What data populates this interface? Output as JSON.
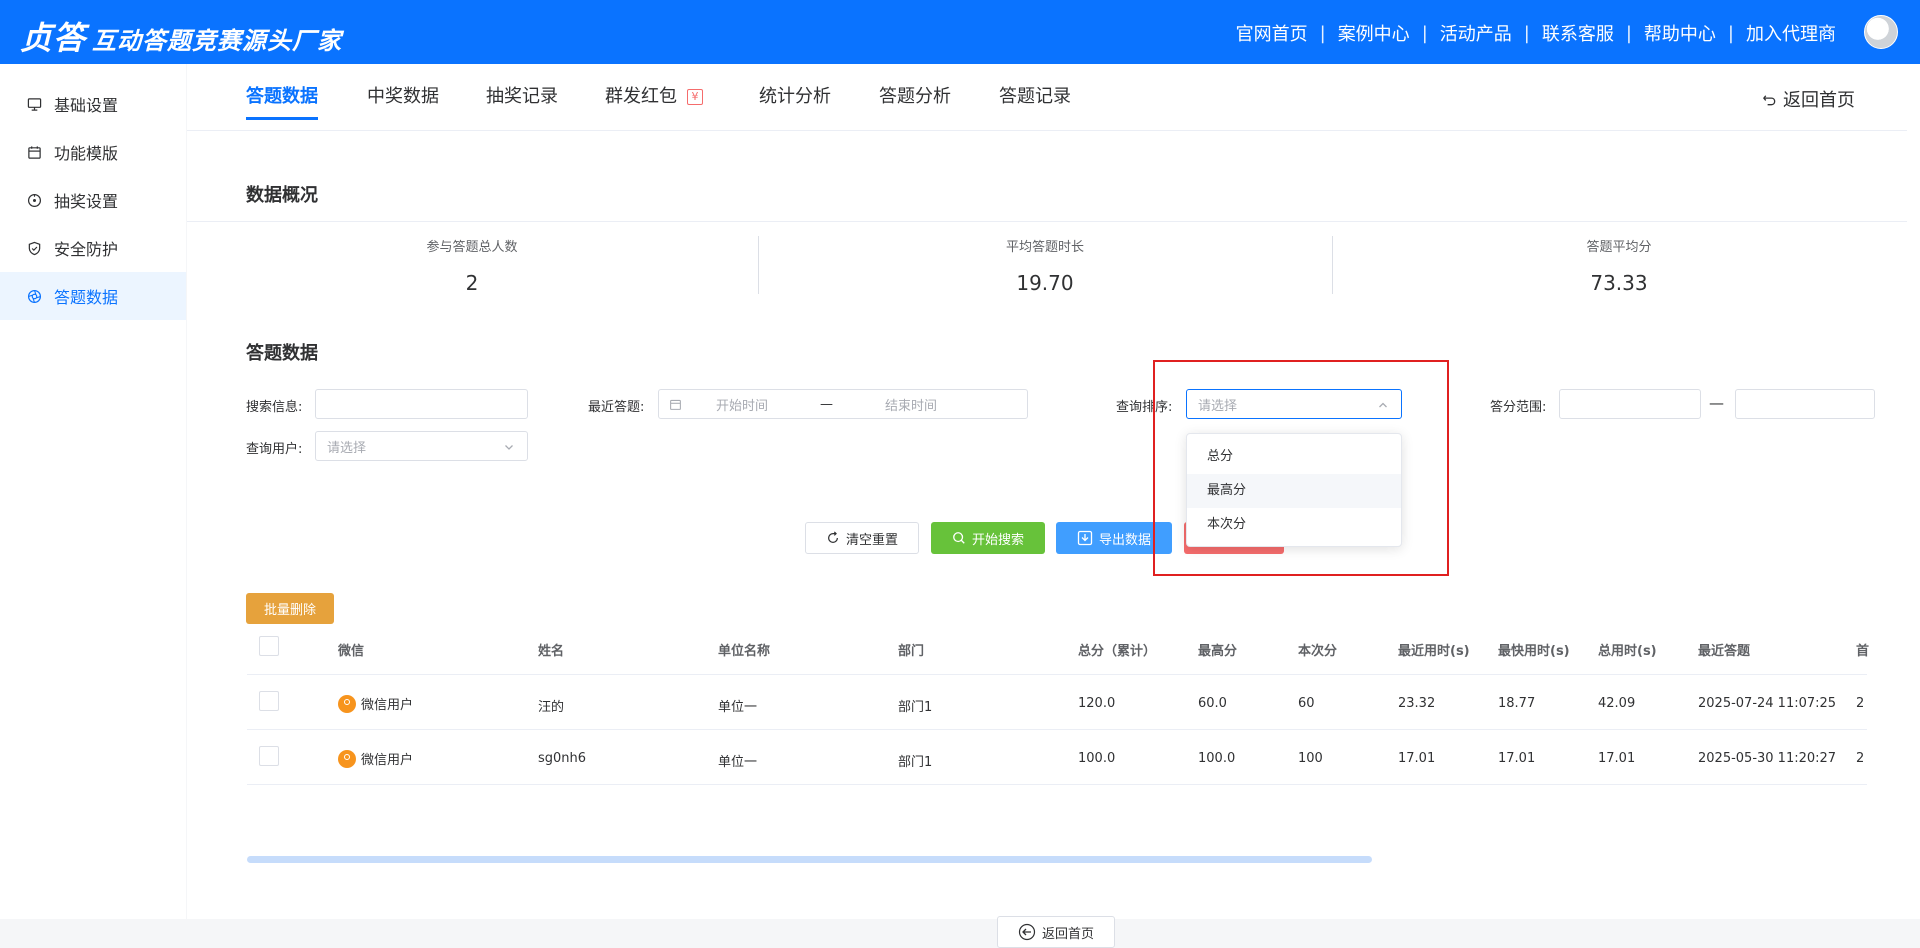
{
  "topbar": {
    "logo_main": "贞答",
    "logo_slogan": "互动答题竞赛源头厂家",
    "nav": [
      "官网首页",
      "案例中心",
      "活动产品",
      "联系客服",
      "帮助中心",
      "加入代理商"
    ],
    "separator": "|"
  },
  "sidebar": {
    "items": [
      {
        "label": "基础设置",
        "icon": "monitor-icon"
      },
      {
        "label": "功能模版",
        "icon": "calendar-icon"
      },
      {
        "label": "抽奖设置",
        "icon": "compass-icon"
      },
      {
        "label": "安全防护",
        "icon": "shield-icon"
      },
      {
        "label": "答题数据",
        "icon": "aperture-icon"
      }
    ],
    "active_index": 4
  },
  "tabs": {
    "items": [
      "答题数据",
      "中奖数据",
      "抽奖记录",
      "群发红包",
      "统计分析",
      "答题分析",
      "答题记录"
    ],
    "active": "答题数据",
    "redpacket_badge": "¥",
    "back_label": "返回首页"
  },
  "overview": {
    "title": "数据概况",
    "stats": [
      {
        "label": "参与答题总人数",
        "value": "2"
      },
      {
        "label": "平均答题时长",
        "value": "19.70"
      },
      {
        "label": "答题平均分",
        "value": "73.33"
      }
    ]
  },
  "filters": {
    "title": "答题数据",
    "search_label": "搜索信息:",
    "recent_label": "最近答题:",
    "start_placeholder": "开始时间",
    "range_sep": "—",
    "end_placeholder": "结束时间",
    "sort_label": "查询排序:",
    "sort_placeholder": "请选择",
    "score_label": "答分范围:",
    "user_label": "查询用户:",
    "user_placeholder": "请选择"
  },
  "sort_dropdown": {
    "options": [
      "总分",
      "最高分",
      "本次分"
    ],
    "hovered": "最高分"
  },
  "buttons": {
    "reset": "清空重置",
    "search": "开始搜索",
    "export": "导出数据",
    "batch_delete": "批量删除",
    "back_home": "返回首页"
  },
  "colors": {
    "primary": "#0a73ff",
    "success": "#67c23a",
    "export": "#409eff",
    "warning": "#e6a23c",
    "danger": "#f56c6c"
  },
  "table": {
    "columns": [
      "微信",
      "姓名",
      "单位名称",
      "部门",
      "总分（累计）",
      "最高分",
      "本次分",
      "最近用时(s)",
      "最快用时(s)",
      "总用时(s)",
      "最近答题",
      "首"
    ],
    "rows": [
      [
        "微信用户",
        "汪的",
        "单位一",
        "部门1",
        "120.0",
        "60.0",
        "60",
        "23.32",
        "18.77",
        "42.09",
        "2025-07-24 11:07:25",
        "2"
      ],
      [
        "微信用户",
        "sg0nh6",
        "单位一",
        "部门1",
        "100.0",
        "100.0",
        "100",
        "17.01",
        "17.01",
        "17.01",
        "2025-05-30 11:20:27",
        "2"
      ]
    ]
  }
}
